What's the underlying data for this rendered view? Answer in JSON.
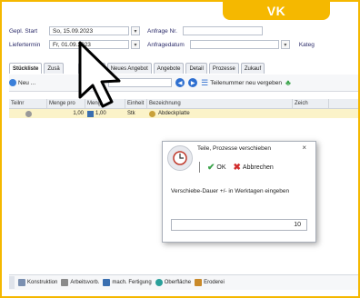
{
  "brand": {
    "tag": "VK",
    "accent": "#f5b800"
  },
  "header": {
    "row1": {
      "label": "Gepl. Start",
      "value": "So, 15.09.2023",
      "label2": "Anfrage Nr."
    },
    "row2": {
      "label": "Liefertermin",
      "value": "Fr, 01.09.2023",
      "label2": "Anfragedatum"
    },
    "extra_label": "Kateg"
  },
  "tabs": [
    "Stückliste",
    "Zusä",
    "lkulation",
    "Neues Angebot",
    "Angebote",
    "Detail",
    "Prozesse",
    "Zukauf"
  ],
  "toolbar": {
    "new_label": "Neu ...",
    "renumber_label": "Teilenummer neu vergeben"
  },
  "grid": {
    "columns": [
      "Teilnr",
      "Menge pro",
      "Menge",
      "Einheit",
      "Bezeichnung",
      "Zeich"
    ],
    "row": {
      "menge_pro": "1,00",
      "menge": "1,00",
      "einheit": "Stk",
      "bezeichnung": "Abdeckplatte"
    }
  },
  "dialog": {
    "title": "Teile, Prozesse verschieben",
    "close": "×",
    "ok_label": "OK",
    "cancel_label": "Abbrechen",
    "message": "Verschiebe-Dauer +/- in Werktagen eingeben",
    "value": "10"
  },
  "bottom": {
    "items": [
      "Konstruktion",
      "Arbeitsvorb.",
      "mach. Fertigung",
      "Oberfläche",
      "Eroderei"
    ]
  }
}
